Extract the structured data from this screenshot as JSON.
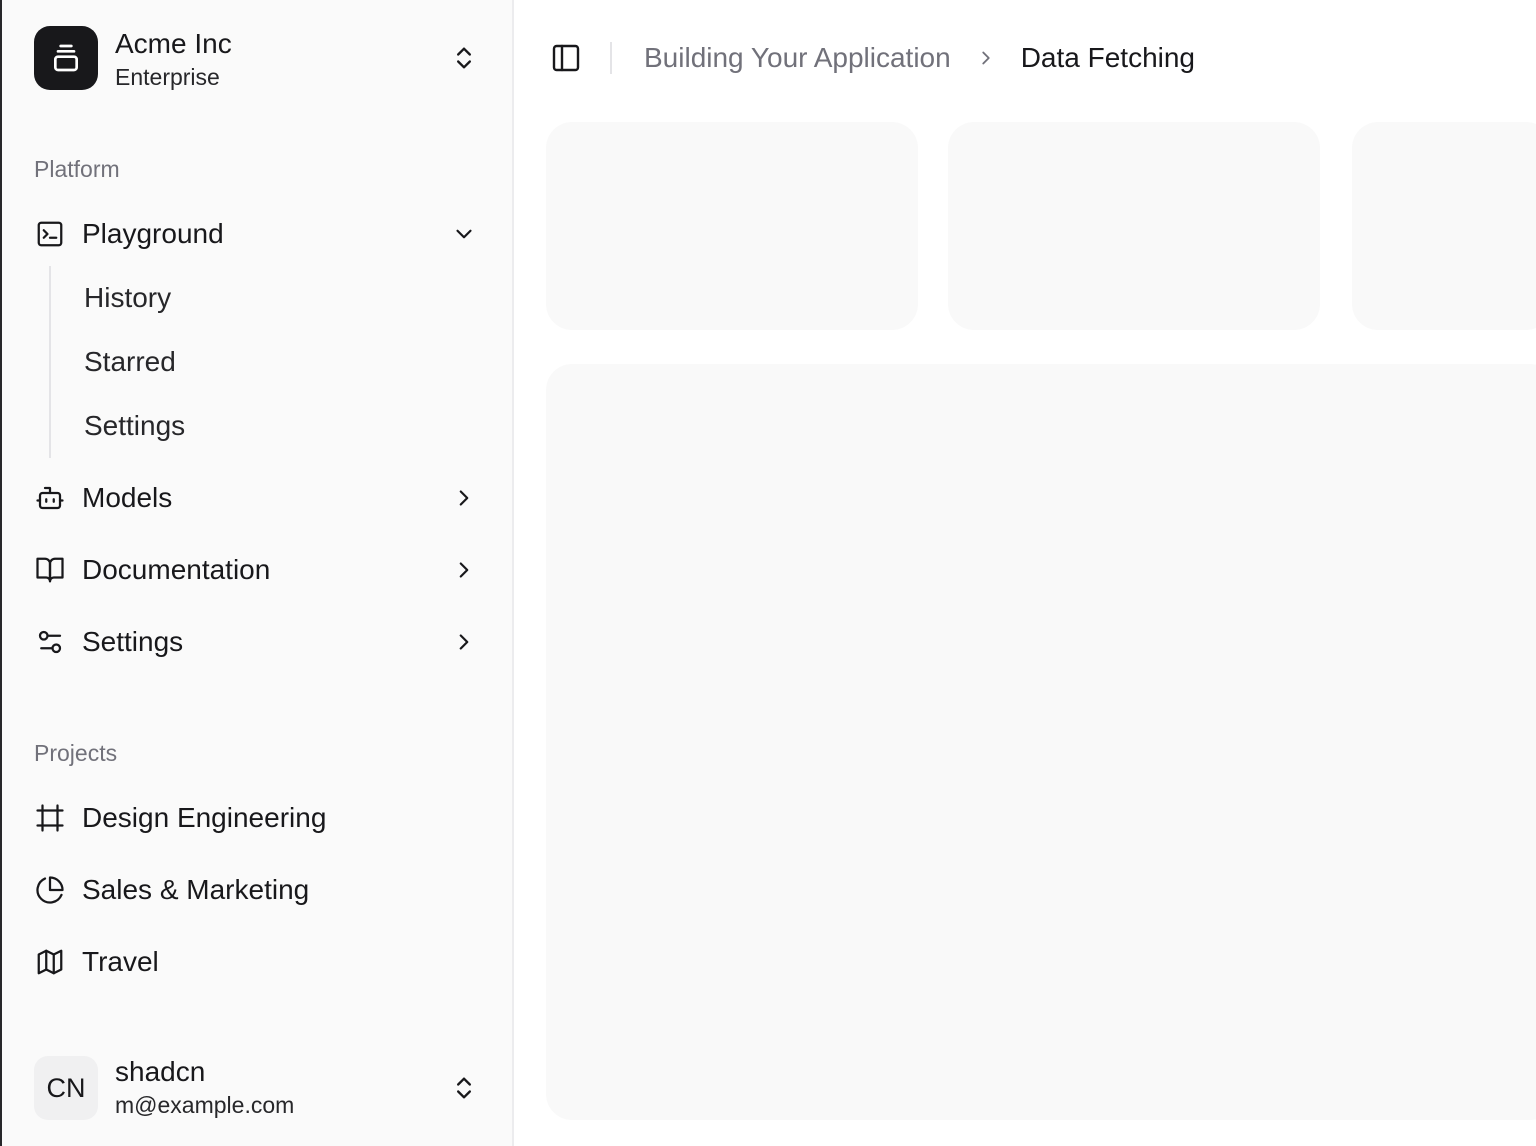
{
  "team": {
    "name": "Acme Inc",
    "plan": "Enterprise"
  },
  "sidebar": {
    "platform_label": "Platform",
    "items": [
      {
        "label": "Playground",
        "icon": "square-terminal-icon",
        "expanded": true,
        "sub_items": [
          {
            "label": "History"
          },
          {
            "label": "Starred"
          },
          {
            "label": "Settings"
          }
        ]
      },
      {
        "label": "Models",
        "icon": "bot-icon"
      },
      {
        "label": "Documentation",
        "icon": "book-open-icon"
      },
      {
        "label": "Settings",
        "icon": "settings-sliders-icon"
      }
    ],
    "projects_label": "Projects",
    "projects": [
      {
        "label": "Design Engineering",
        "icon": "frame-icon"
      },
      {
        "label": "Sales & Marketing",
        "icon": "pie-chart-icon"
      },
      {
        "label": "Travel",
        "icon": "map-icon"
      }
    ]
  },
  "user": {
    "initials": "CN",
    "name": "shadcn",
    "email": "m@example.com"
  },
  "header": {
    "breadcrumb": [
      {
        "label": "Building Your Application"
      },
      {
        "label": "Data Fetching"
      }
    ]
  },
  "colors": {
    "sidebar_bg": "#fafafa",
    "placeholder_bg": "#f9f9f9",
    "text": "#18181b",
    "muted": "#71717a"
  }
}
